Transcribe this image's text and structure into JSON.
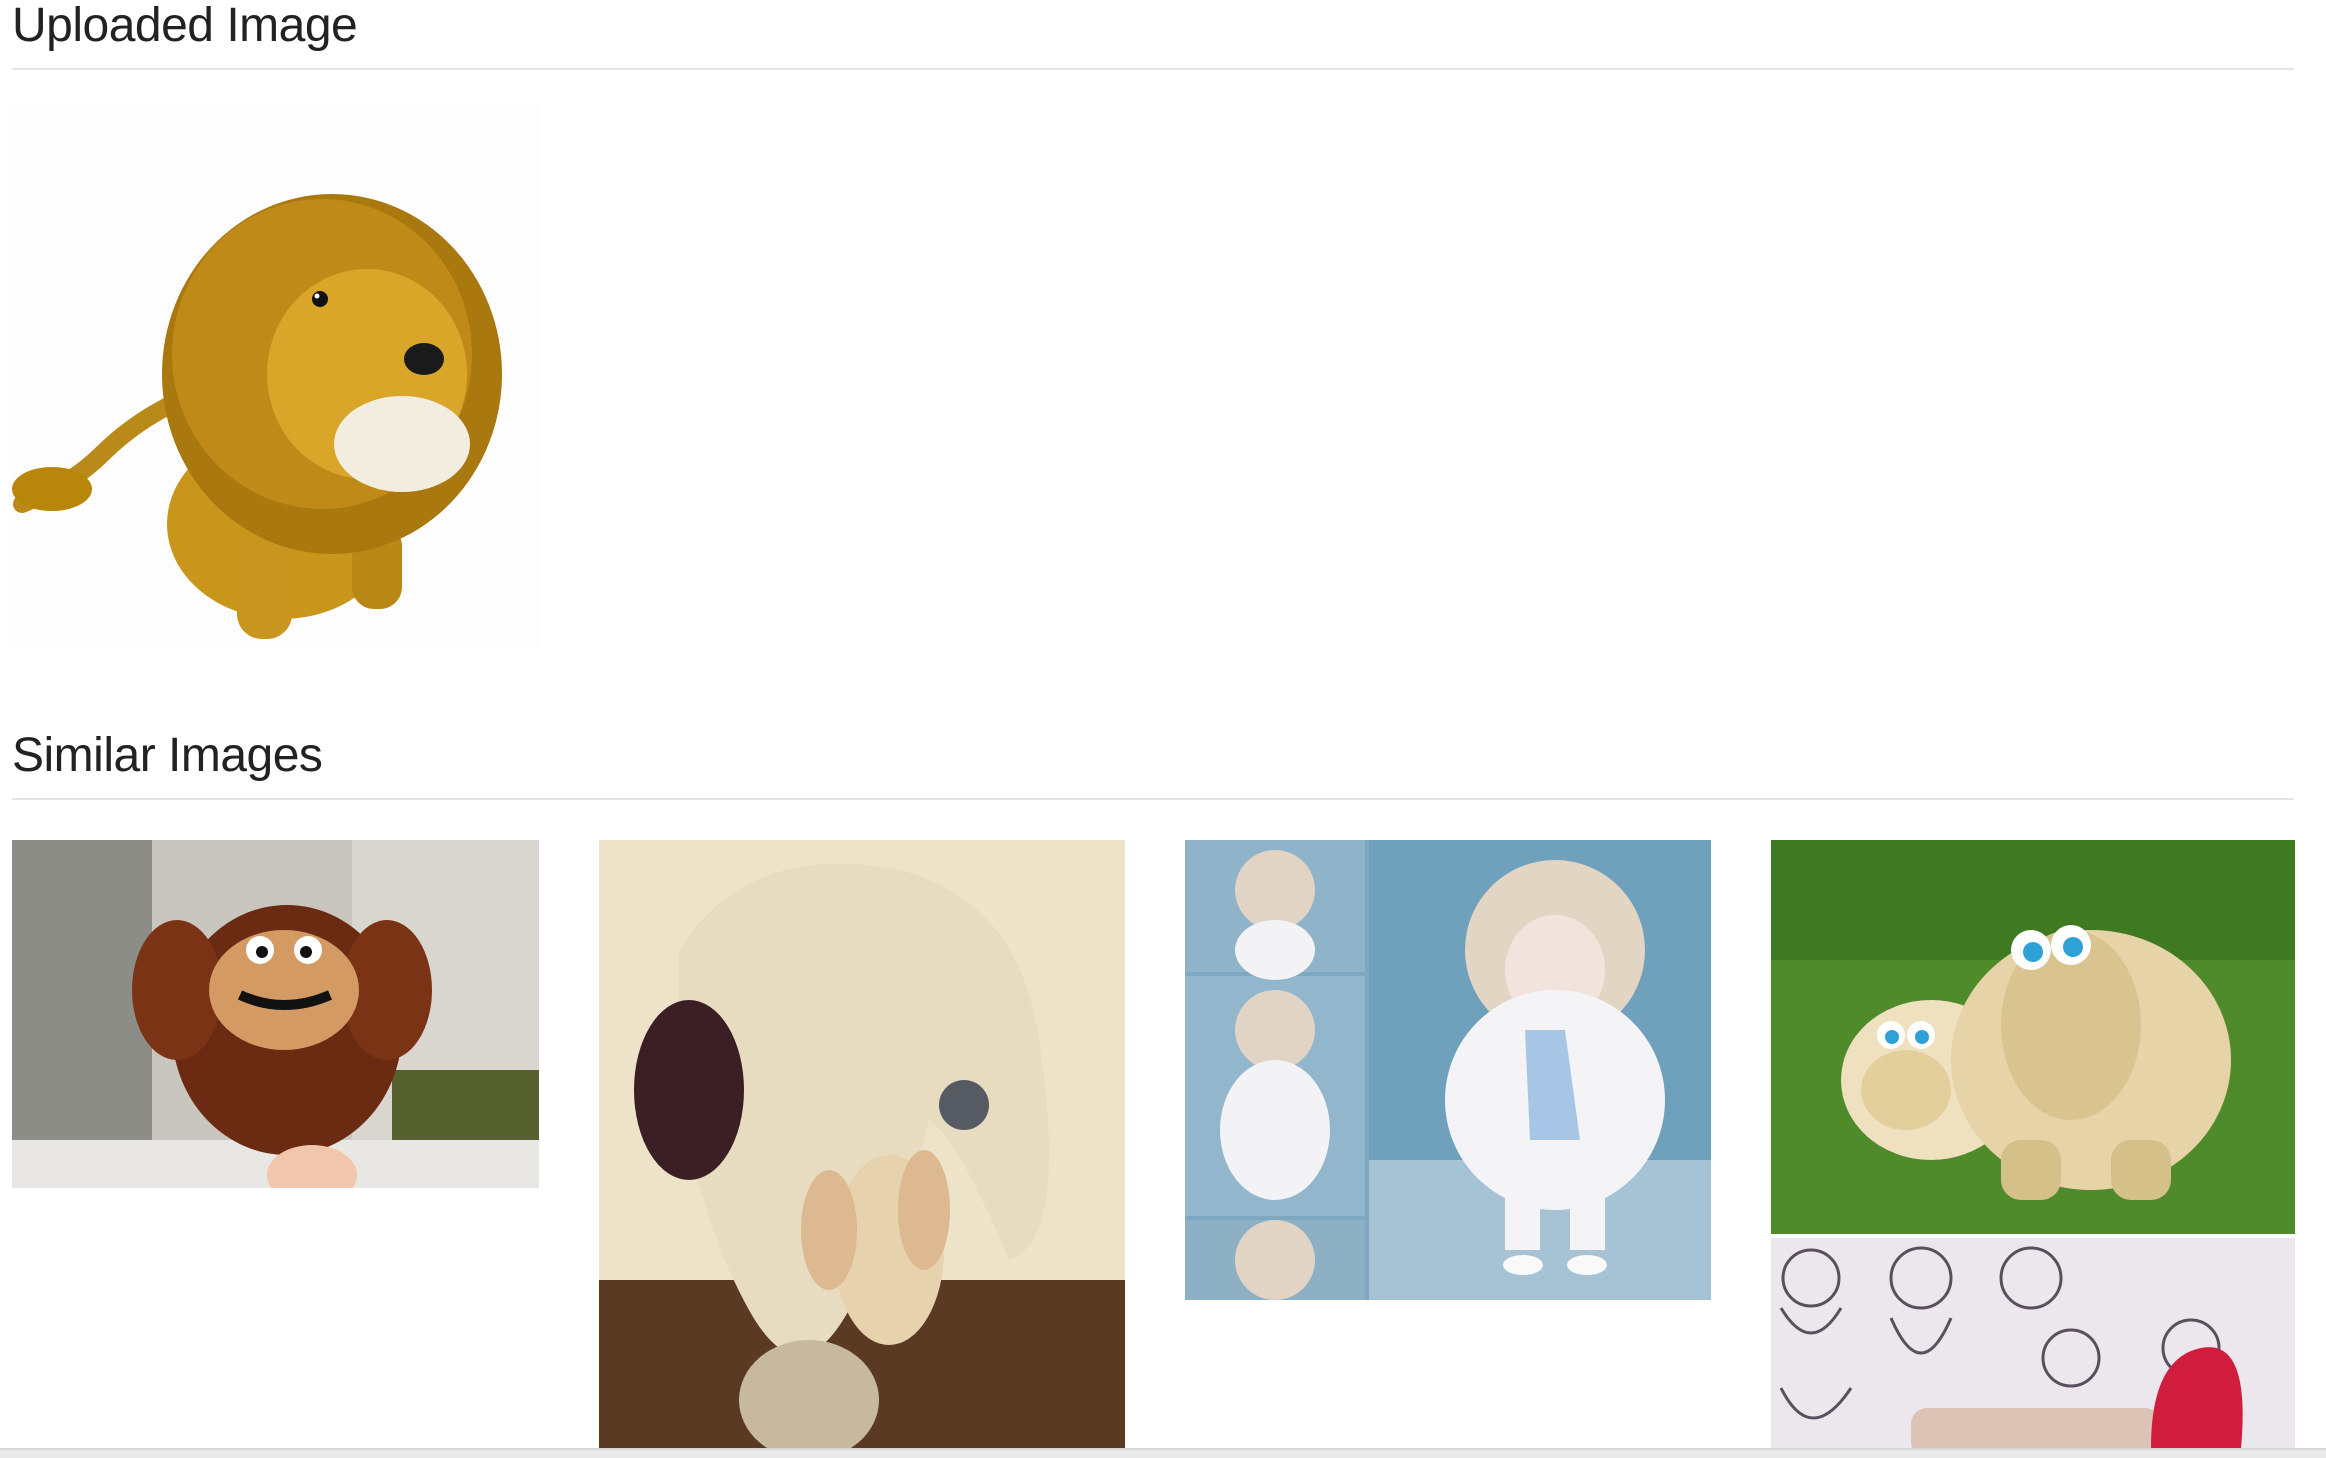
{
  "uploaded": {
    "heading": "Uploaded Image",
    "image": {
      "subject": "plush lion toy"
    }
  },
  "similar": {
    "heading": "Similar Images",
    "images": [
      {
        "subject": "brown furry finger puppet"
      },
      {
        "subject": "cream fabric elephant plush"
      },
      {
        "subject": "collage of a curly-haired doll in white fur outfit"
      },
      {
        "subject": "two fluffy sheep plush toys on grass"
      },
      {
        "subject": "pencil sketches of bears with a red object"
      }
    ]
  },
  "colors": {
    "heading_text": "#222222",
    "rule": "#e5e5e5",
    "background": "#ffffff"
  }
}
